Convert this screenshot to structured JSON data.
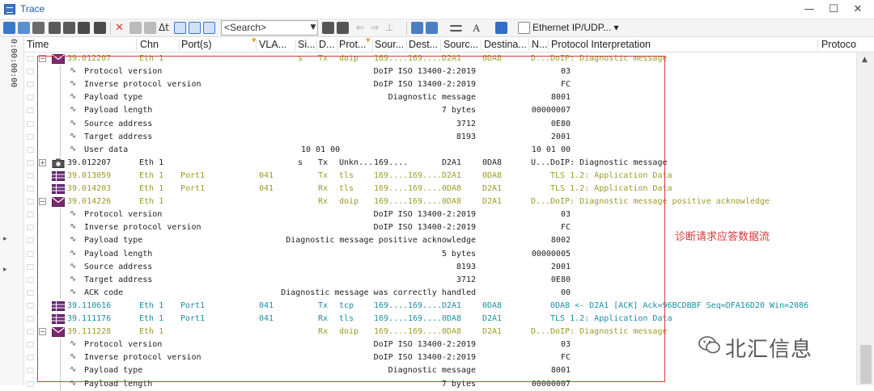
{
  "window": {
    "title": "Trace",
    "minimize": "—",
    "maximize": "☐",
    "close": "✕"
  },
  "toolbar": {
    "search_placeholder": "<Search>",
    "filter_label": "Ethernet IP/UDP...",
    "delta_label": "Δt",
    "font_label": "A"
  },
  "gutter": {
    "time": "0:00:00:00"
  },
  "header": {
    "time": "Time",
    "chn": "Chn",
    "ports": "Port(s)",
    "vlan": "VLA...",
    "si": "Si...",
    "d": "D...",
    "prot": "Prot...",
    "sour": "Sour...",
    "dest": "Dest...",
    "source": "Sourc...",
    "destina": "Destina...",
    "n": "N...",
    "interp": "Protocol Interpretation",
    "protoc": "Protoco"
  },
  "colors": {
    "green_row": "#9a9a2a",
    "teal_row": "#1b8ca5",
    "annotation": "#d23a3a"
  },
  "rows": [
    {
      "kind": "msg",
      "color": "green",
      "icon": "envelope-icon",
      "expanded": "−",
      "time": "39.012207",
      "chn": "Eth 1",
      "port": "",
      "vlan": "",
      "si": "s",
      "d": "Tx",
      "prot": "doip",
      "sour": "169....",
      "dest": "169....",
      "src": "D2A1",
      "dst": "0DA8",
      "n": "D...",
      "interp": "DoIP: Diagnostic message"
    },
    {
      "kind": "leaf",
      "name": "Protocol version",
      "value": "DoIP ISO 13400-2:2019",
      "raw": "03"
    },
    {
      "kind": "leaf",
      "name": "Inverse protocol version",
      "value": "DoIP ISO 13400-2:2019",
      "raw": "FC"
    },
    {
      "kind": "leaf",
      "name": "Payload type",
      "value": "Diagnostic message",
      "raw": "8001"
    },
    {
      "kind": "leaf",
      "name": "Payload length",
      "value": "7 bytes",
      "raw": "00000007"
    },
    {
      "kind": "leaf",
      "name": "Source address",
      "value": "3712",
      "raw": "0E80"
    },
    {
      "kind": "leaf",
      "name": "Target address",
      "value": "8193",
      "raw": "2001"
    },
    {
      "kind": "leaf",
      "name": "User data",
      "value": "10 01 00",
      "raw": "10 01 00",
      "mid": true
    },
    {
      "kind": "msg",
      "color": "black",
      "icon": "camera-icon",
      "expanded": "+",
      "time": "39.012207",
      "chn": "Eth 1",
      "port": "",
      "vlan": "",
      "si": "s",
      "d": "Tx",
      "prot": "Unkn...",
      "sour": "169....",
      "dest": "",
      "src": "D2A1",
      "dst": "0DA8",
      "n": "U...",
      "interp": "DoIP: Diagnostic message"
    },
    {
      "kind": "msg",
      "color": "green",
      "icon": "grid-icon",
      "time": "39.013059",
      "chn": "Eth 1",
      "port": "Port1",
      "vlan": "041",
      "si": "",
      "d": "Tx",
      "prot": "tls",
      "sour": "169....",
      "dest": "169....",
      "src": "D2A1",
      "dst": "0DA8",
      "n": "",
      "interp": "TLS 1.2: Application Data"
    },
    {
      "kind": "msg",
      "color": "green",
      "icon": "grid-icon",
      "time": "39.014203",
      "chn": "Eth 1",
      "port": "Port1",
      "vlan": "041",
      "si": "",
      "d": "Rx",
      "prot": "tls",
      "sour": "169....",
      "dest": "169....",
      "src": "0DA8",
      "dst": "D2A1",
      "n": "",
      "interp": "TLS 1.2: Application Data"
    },
    {
      "kind": "msg",
      "color": "green",
      "icon": "envelope-icon",
      "expanded": "−",
      "time": "39.014226",
      "chn": "Eth 1",
      "port": "",
      "vlan": "",
      "si": "",
      "d": "Rx",
      "prot": "doip",
      "sour": "169....",
      "dest": "169....",
      "src": "0DA8",
      "dst": "D2A1",
      "n": "D...",
      "interp": "DoIP: Diagnostic message positive acknowledge"
    },
    {
      "kind": "leaf",
      "name": "Protocol version",
      "value": "DoIP ISO 13400-2:2019",
      "raw": "03"
    },
    {
      "kind": "leaf",
      "name": "Inverse protocol version",
      "value": "DoIP ISO 13400-2:2019",
      "raw": "FC"
    },
    {
      "kind": "leaf",
      "name": "Payload type",
      "value": "Diagnostic message positive acknowledge",
      "raw": "8002"
    },
    {
      "kind": "leaf",
      "name": "Payload length",
      "value": "5 bytes",
      "raw": "00000005"
    },
    {
      "kind": "leaf",
      "name": "Source address",
      "value": "8193",
      "raw": "2001"
    },
    {
      "kind": "leaf",
      "name": "Target address",
      "value": "3712",
      "raw": "0E80"
    },
    {
      "kind": "leaf",
      "name": "ACK code",
      "value": "Diagnostic message was correctly handled",
      "raw": "00"
    },
    {
      "kind": "msg",
      "color": "teal",
      "icon": "grid-icon",
      "time": "39.110616",
      "chn": "Eth 1",
      "port": "Port1",
      "vlan": "041",
      "si": "",
      "d": "Tx",
      "prot": "tcp",
      "sour": "169....",
      "dest": "169....",
      "src": "D2A1",
      "dst": "0DA8",
      "n": "",
      "interp": "0DA8 <- D2A1 [ACK] Ack=96BCDBBF Seq=DFA16D20 Win=2086"
    },
    {
      "kind": "msg",
      "color": "teal",
      "icon": "grid-icon",
      "time": "39.111176",
      "chn": "Eth 1",
      "port": "Port1",
      "vlan": "041",
      "si": "",
      "d": "Rx",
      "prot": "tls",
      "sour": "169....",
      "dest": "169....",
      "src": "0DA8",
      "dst": "D2A1",
      "n": "",
      "interp": "TLS 1.2: Application Data"
    },
    {
      "kind": "msg",
      "color": "green",
      "icon": "envelope-icon",
      "expanded": "−",
      "time": "39.111228",
      "chn": "Eth 1",
      "port": "",
      "vlan": "",
      "si": "",
      "d": "Rx",
      "prot": "doip",
      "sour": "169....",
      "dest": "169....",
      "src": "0DA8",
      "dst": "D2A1",
      "n": "D...",
      "interp": "DoIP: Diagnostic message"
    },
    {
      "kind": "leaf",
      "name": "Protocol version",
      "value": "DoIP ISO 13400-2:2019",
      "raw": "03"
    },
    {
      "kind": "leaf",
      "name": "Inverse protocol version",
      "value": "DoIP ISO 13400-2:2019",
      "raw": "FC"
    },
    {
      "kind": "leaf",
      "name": "Payload type",
      "value": "Diagnostic message",
      "raw": "8001"
    },
    {
      "kind": "leaf",
      "name": "Payload length",
      "value": "7 bytes",
      "raw": "00000007"
    }
  ],
  "annotation": "诊断请求应答数据流",
  "watermark": "北汇信息"
}
